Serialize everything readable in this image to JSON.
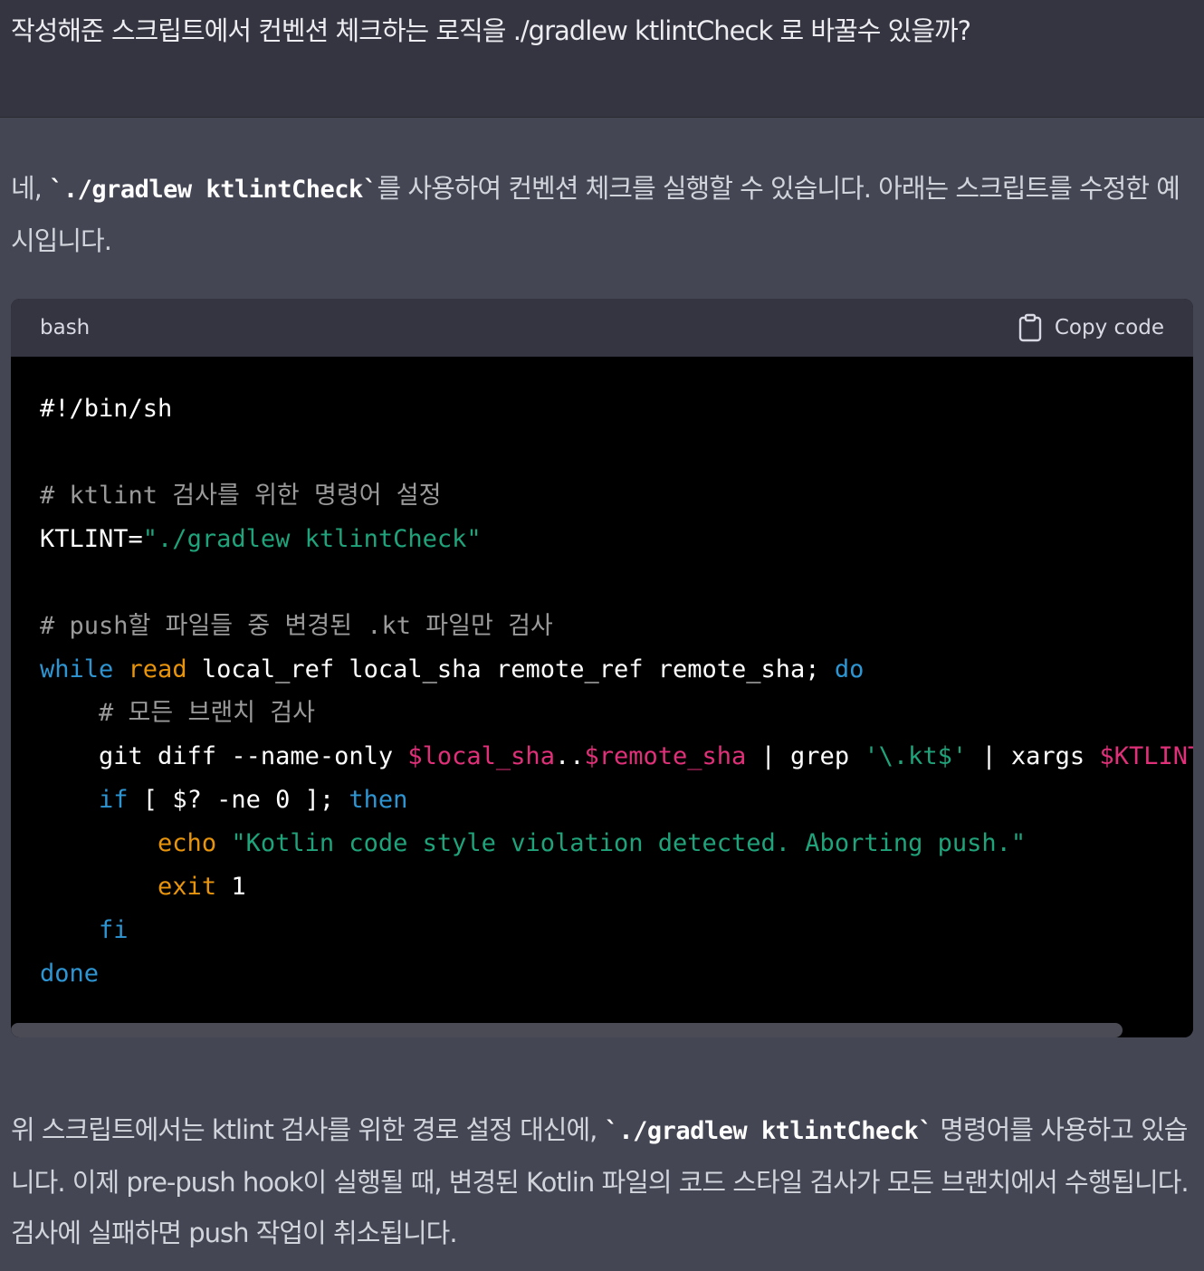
{
  "user_message": {
    "text": "작성해준 스크립트에서 컨벤션 체크하는 로직을  ./gradlew ktlintCheck 로 바꿀수 있을까?"
  },
  "assistant": {
    "intro_before": "네, ",
    "intro_code": "`./gradlew ktlintCheck`",
    "intro_after": "를 사용하여 컨벤션 체크를 실행할 수 있습니다. 아래는 스크립트를 수정한 예시입니다.",
    "code_block": {
      "language": "bash",
      "copy_label": "Copy code",
      "copy_icon": "clipboard-icon",
      "horizontal_scroll_fraction": 0.94,
      "lines": [
        [
          {
            "t": "#!/bin/sh",
            "k": "plain"
          }
        ],
        [],
        [
          {
            "t": "# ktlint 검사를 위한 명령어 설정",
            "k": "comment"
          }
        ],
        [
          {
            "t": "KTLINT=",
            "k": "plain"
          },
          {
            "t": "\"./gradlew ktlintCheck\"",
            "k": "str"
          }
        ],
        [],
        [
          {
            "t": "# push할 파일들 중 변경된 .kt 파일만 검사",
            "k": "comment"
          }
        ],
        [
          {
            "t": "while",
            "k": "kw"
          },
          {
            "t": " ",
            "k": "plain"
          },
          {
            "t": "read",
            "k": "builtin"
          },
          {
            "t": " local_ref local_sha remote_ref remote_sha; ",
            "k": "plain"
          },
          {
            "t": "do",
            "k": "kw"
          }
        ],
        [
          {
            "t": "    ",
            "k": "plain"
          },
          {
            "t": "# 모든 브랜치 검사",
            "k": "comment"
          }
        ],
        [
          {
            "t": "    git diff --name-only ",
            "k": "plain"
          },
          {
            "t": "$local_sha",
            "k": "var"
          },
          {
            "t": "..",
            "k": "plain"
          },
          {
            "t": "$remote_sha",
            "k": "var"
          },
          {
            "t": " | grep ",
            "k": "plain"
          },
          {
            "t": "'\\.kt$'",
            "k": "str"
          },
          {
            "t": " | xargs ",
            "k": "plain"
          },
          {
            "t": "$KTLINT",
            "k": "var"
          }
        ],
        [
          {
            "t": "    ",
            "k": "plain"
          },
          {
            "t": "if",
            "k": "kw"
          },
          {
            "t": " [ $? -ne 0 ]; ",
            "k": "plain"
          },
          {
            "t": "then",
            "k": "kw"
          }
        ],
        [
          {
            "t": "        ",
            "k": "plain"
          },
          {
            "t": "echo",
            "k": "builtin"
          },
          {
            "t": " ",
            "k": "plain"
          },
          {
            "t": "\"Kotlin code style violation detected. Aborting push.\"",
            "k": "str"
          }
        ],
        [
          {
            "t": "        ",
            "k": "plain"
          },
          {
            "t": "exit",
            "k": "builtin"
          },
          {
            "t": " 1",
            "k": "plain"
          }
        ],
        [
          {
            "t": "    ",
            "k": "plain"
          },
          {
            "t": "fi",
            "k": "kw"
          }
        ],
        [
          {
            "t": "done",
            "k": "kw"
          }
        ]
      ]
    },
    "outro_before": "위 스크립트에서는 ktlint 검사를 위한 경로 설정 대신에, ",
    "outro_code": "`./gradlew ktlintCheck`",
    "outro_after": " 명령어를 사용하고 있습니다. 이제 pre-push hook이 실행될 때, 변경된 Kotlin 파일의 코드 스타일 검사가 모든 브랜치에서 수행됩니다. 검사에 실패하면 push 작업이 취소됩니다."
  }
}
